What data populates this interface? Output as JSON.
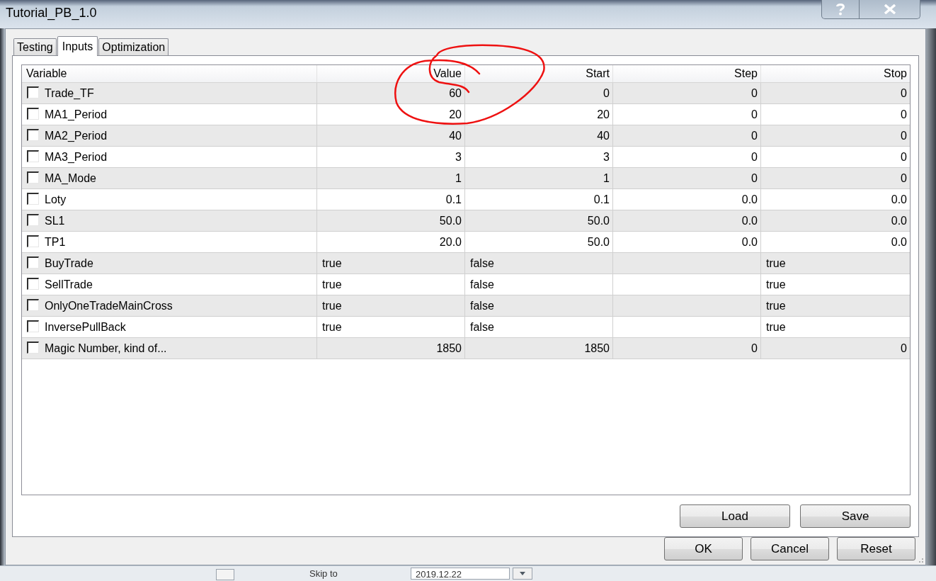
{
  "window": {
    "title": "Tutorial_PB_1.0"
  },
  "tabs": [
    {
      "label": "Testing",
      "selected": false
    },
    {
      "label": "Inputs",
      "selected": true
    },
    {
      "label": "Optimization",
      "selected": false
    }
  ],
  "table": {
    "columns": [
      "Variable",
      "Value",
      "Start",
      "Step",
      "Stop"
    ],
    "rows": [
      {
        "kind": "number",
        "checked": false,
        "variable": "Trade_TF",
        "value": "60",
        "start": "0",
        "step": "0",
        "stop": "0"
      },
      {
        "kind": "number",
        "checked": false,
        "variable": "MA1_Period",
        "value": "20",
        "start": "20",
        "step": "0",
        "stop": "0"
      },
      {
        "kind": "number",
        "checked": false,
        "variable": "MA2_Period",
        "value": "40",
        "start": "40",
        "step": "0",
        "stop": "0"
      },
      {
        "kind": "number",
        "checked": false,
        "variable": "MA3_Period",
        "value": "3",
        "start": "3",
        "step": "0",
        "stop": "0"
      },
      {
        "kind": "number",
        "checked": false,
        "variable": "MA_Mode",
        "value": "1",
        "start": "1",
        "step": "0",
        "stop": "0"
      },
      {
        "kind": "number",
        "checked": false,
        "variable": "Loty",
        "value": "0.1",
        "start": "0.1",
        "step": "0.0",
        "stop": "0.0"
      },
      {
        "kind": "number",
        "checked": false,
        "variable": "SL1",
        "value": "50.0",
        "start": "50.0",
        "step": "0.0",
        "stop": "0.0"
      },
      {
        "kind": "number",
        "checked": false,
        "variable": "TP1",
        "value": "20.0",
        "start": "50.0",
        "step": "0.0",
        "stop": "0.0"
      },
      {
        "kind": "bool",
        "checked": false,
        "variable": "BuyTrade",
        "value": "true",
        "start": "false",
        "stop": "true"
      },
      {
        "kind": "bool",
        "checked": false,
        "variable": "SellTrade",
        "value": "true",
        "start": "false",
        "stop": "true"
      },
      {
        "kind": "bool",
        "checked": false,
        "variable": "OnlyOneTradeMainCross",
        "value": "true",
        "start": "false",
        "stop": "true"
      },
      {
        "kind": "bool",
        "checked": false,
        "variable": "InversePullBack",
        "value": "true",
        "start": "false",
        "stop": "true"
      },
      {
        "kind": "number",
        "checked": false,
        "variable": "Magic Number, kind of...",
        "value": "1850",
        "start": "1850",
        "step": "0",
        "stop": "0"
      }
    ]
  },
  "file_buttons": [
    "Load",
    "Save"
  ],
  "dialog_buttons": [
    "OK",
    "Cancel",
    "Reset"
  ],
  "background_window": {
    "label": "Skip to",
    "date": "2019.12.22"
  }
}
